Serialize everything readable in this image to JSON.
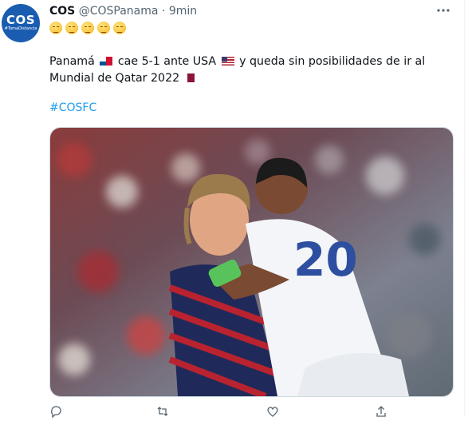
{
  "tweet": {
    "avatar_logo": "COS",
    "avatar_tag": "#TomaDistancia",
    "display_name": "COS",
    "handle": "@COSPanama",
    "separator": "·",
    "time": "9min",
    "emoji_count": 5,
    "emoji_icon": "pensive-face-emoji",
    "text_part1": "Panamá",
    "text_part2": "cae 5-1 ante USA",
    "text_part3": "y queda sin posibilidades de ir al Mundial de Qatar 2022",
    "hashtag": "#COSFC",
    "jersey_number": "20"
  },
  "icons": {
    "more": "more-options-icon",
    "reply": "reply-icon",
    "retweet": "retweet-icon",
    "like": "heart-icon",
    "share": "share-icon"
  },
  "colors": {
    "link": "#1d9bf0",
    "secondary_text": "#536471",
    "avatar_bg": "#1a5db0"
  }
}
